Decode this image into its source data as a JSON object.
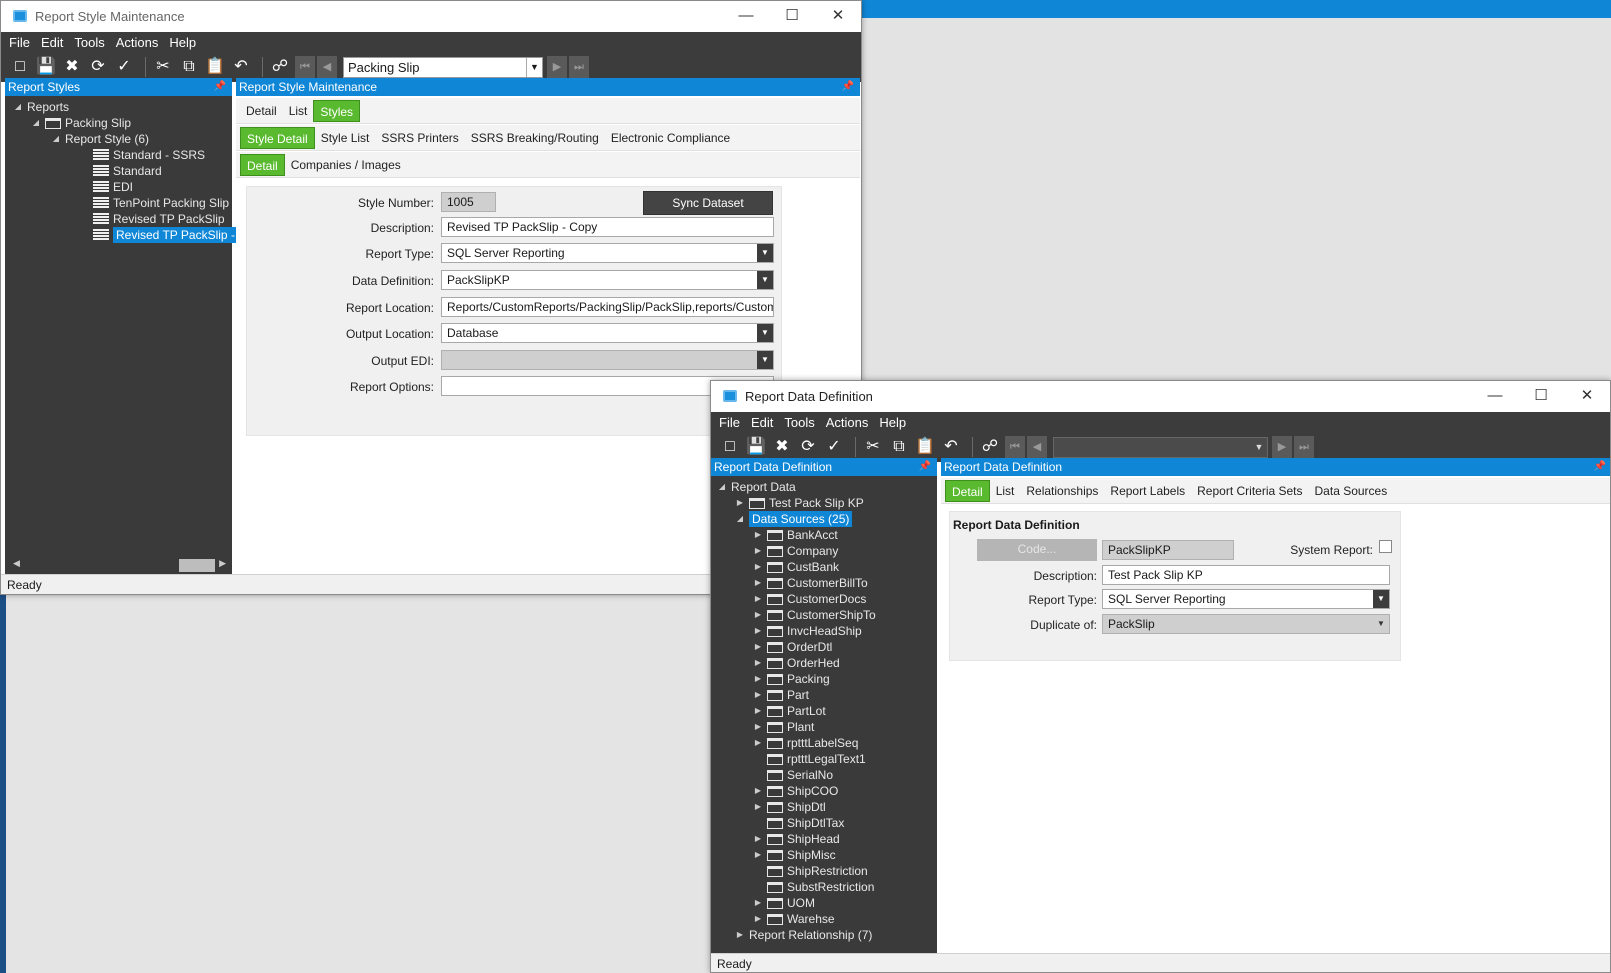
{
  "win1": {
    "title": "Report Style Maintenance",
    "menu": [
      "File",
      "Edit",
      "Tools",
      "Actions",
      "Help"
    ],
    "combo": "Packing Slip",
    "tree_header": "Report Styles",
    "tree": [
      {
        "label": "Reports",
        "level": 0,
        "twisty": "◢",
        "icon": "none"
      },
      {
        "label": "Packing Slip",
        "level": 1,
        "twisty": "◢",
        "icon": "folder"
      },
      {
        "label": "Report Style (6)",
        "level": 2,
        "twisty": "◢",
        "icon": "none"
      },
      {
        "label": "Standard - SSRS",
        "level": 3,
        "twisty": "",
        "icon": "doc"
      },
      {
        "label": "Standard",
        "level": 3,
        "twisty": "",
        "icon": "doc"
      },
      {
        "label": "EDI",
        "level": 3,
        "twisty": "",
        "icon": "doc"
      },
      {
        "label": "TenPoint Packing Slip",
        "level": 3,
        "twisty": "",
        "icon": "doc"
      },
      {
        "label": "Revised TP PackSlip",
        "level": 3,
        "twisty": "",
        "icon": "doc"
      },
      {
        "label": "Revised TP PackSlip - C",
        "level": 3,
        "twisty": "",
        "icon": "doc",
        "selected": true
      }
    ],
    "content_header": "Report Style Maintenance",
    "tabs1": [
      "Detail",
      "List",
      "Styles"
    ],
    "tabs2": [
      "Style Detail",
      "Style List",
      "SSRS Printers",
      "SSRS Breaking/Routing",
      "Electronic Compliance"
    ],
    "tabs3": [
      "Detail",
      "Companies / Images"
    ],
    "form": {
      "style_number_label": "Style Number:",
      "style_number": "1005",
      "sync_button": "Sync Dataset",
      "description_label": "Description:",
      "description": "Revised TP PackSlip - Copy",
      "report_type_label": "Report Type:",
      "report_type": "SQL Server Reporting",
      "data_definition_label": "Data Definition:",
      "data_definition": "PackSlipKP",
      "report_location_label": "Report Location:",
      "report_location": "Reports/CustomReports/PackingSlip/PackSlip,reports/CustomR",
      "output_location_label": "Output Location:",
      "output_location": "Database",
      "output_edi_label": "Output EDI:",
      "output_edi": "",
      "report_options_label": "Report Options:",
      "report_options": ""
    },
    "status": "Ready"
  },
  "win2": {
    "title": "Report Data Definition",
    "menu": [
      "File",
      "Edit",
      "Tools",
      "Actions",
      "Help"
    ],
    "tree_header": "Report Data Definition",
    "tree_root": "Report Data",
    "tree_test": "Test Pack Slip KP",
    "tree_sources": "Data Sources (25)",
    "sources": [
      {
        "label": "BankAcct",
        "twisty": true
      },
      {
        "label": "Company",
        "twisty": true
      },
      {
        "label": "CustBank",
        "twisty": true
      },
      {
        "label": "CustomerBillTo",
        "twisty": true
      },
      {
        "label": "CustomerDocs",
        "twisty": true
      },
      {
        "label": "CustomerShipTo",
        "twisty": true
      },
      {
        "label": "InvcHeadShip",
        "twisty": true
      },
      {
        "label": "OrderDtl",
        "twisty": true
      },
      {
        "label": "OrderHed",
        "twisty": true
      },
      {
        "label": "Packing",
        "twisty": true
      },
      {
        "label": "Part",
        "twisty": true
      },
      {
        "label": "PartLot",
        "twisty": true
      },
      {
        "label": "Plant",
        "twisty": true
      },
      {
        "label": "rptttLabelSeq",
        "twisty": true
      },
      {
        "label": "rptttLegalText1",
        "twisty": false
      },
      {
        "label": "SerialNo",
        "twisty": false
      },
      {
        "label": "ShipCOO",
        "twisty": true
      },
      {
        "label": "ShipDtl",
        "twisty": true
      },
      {
        "label": "ShipDtlTax",
        "twisty": false
      },
      {
        "label": "ShipHead",
        "twisty": true
      },
      {
        "label": "ShipMisc",
        "twisty": true
      },
      {
        "label": "ShipRestriction",
        "twisty": false
      },
      {
        "label": "SubstRestriction",
        "twisty": false
      },
      {
        "label": "UOM",
        "twisty": true
      },
      {
        "label": "Warehse",
        "twisty": true
      }
    ],
    "tree_relationship": "Report Relationship (7)",
    "content_header": "Report Data Definition",
    "tabs": [
      "Detail",
      "List",
      "Relationships",
      "Report Labels",
      "Report Criteria Sets",
      "Data Sources"
    ],
    "form": {
      "section_title": "Report Data Definition",
      "code_button": "Code...",
      "code": "PackSlipKP",
      "system_report_label": "System Report:",
      "description_label": "Description:",
      "description": "Test Pack Slip KP",
      "report_type_label": "Report Type:",
      "report_type": "SQL Server Reporting",
      "duplicate_label": "Duplicate of:",
      "duplicate": "PackSlip"
    },
    "status": "Ready"
  }
}
